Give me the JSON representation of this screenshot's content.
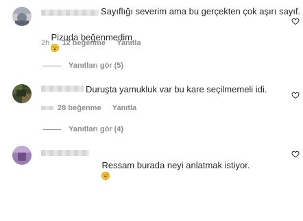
{
  "comments": [
    {
      "text_line1": "Sayıflığı severim ama bu gerçekten çok aşırı sayıf.",
      "text_line2": "Pizuda beğenmedim",
      "emoji": "surprised-face",
      "time": "2h",
      "likes": "12 beğenme",
      "reply": "Yanıtla",
      "view_replies": "Yanıtları gör (5)"
    },
    {
      "text_line1": "Duruşta yamukluk var bu kare seçilmemeli idi.",
      "time": "2h",
      "likes": "28 beğenme",
      "reply": "Yanıtla",
      "view_replies": "Yanıtları gör (4)"
    },
    {
      "text_line1": "Ressam burada neyi anlatmak istiyor.",
      "emoji": "grinning-sweat-face"
    }
  ],
  "colors": {
    "text": "#262626",
    "secondary": "#8e8e8e",
    "emoji_yellow": "#f6c33b"
  }
}
